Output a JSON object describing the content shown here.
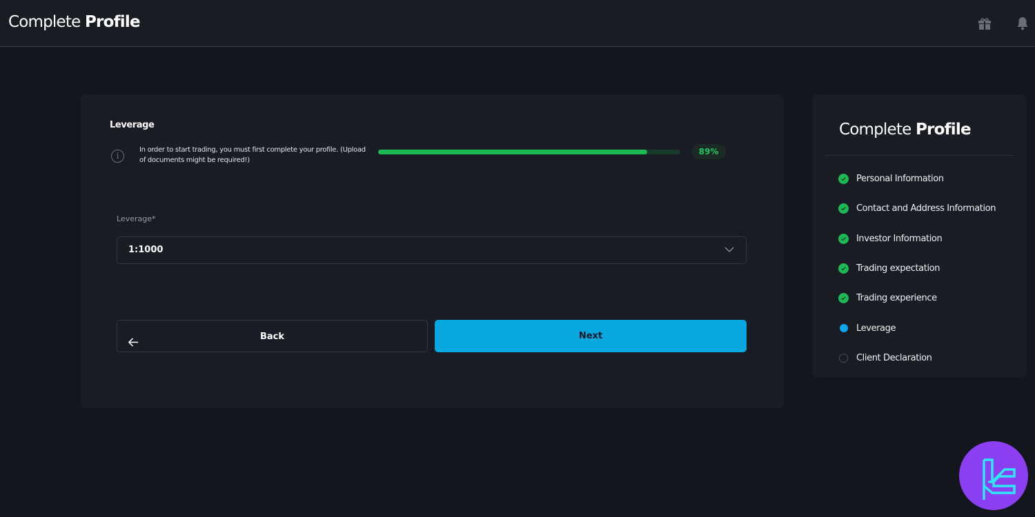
{
  "header": {
    "title_light": "Complete",
    "title_bold": "Profile",
    "icons": [
      "gift-icon",
      "bell-icon"
    ]
  },
  "form": {
    "section_title": "Leverage",
    "info_text": "In order to start trading, you must first complete your profile. (Upload of documents might be required!)",
    "progress_percent": 89,
    "progress_label": "89%",
    "leverage_label": "Leverage*",
    "leverage_value": "1:1000",
    "back_label": "Back",
    "next_label": "Next"
  },
  "sidebar": {
    "title_light": "Complete",
    "title_bold": "Profile",
    "steps": [
      {
        "label": "Personal Information",
        "status": "done"
      },
      {
        "label": "Contact and Address Information",
        "status": "done"
      },
      {
        "label": "Investor Information",
        "status": "done"
      },
      {
        "label": "Trading expectation",
        "status": "done"
      },
      {
        "label": "Trading experience",
        "status": "done"
      },
      {
        "label": "Leverage",
        "status": "current"
      },
      {
        "label": "Client Declaration",
        "status": "pending"
      }
    ]
  },
  "colors": {
    "accent": "#07a8e0",
    "success": "#1db954",
    "current_step": "#0ea5e9",
    "badge": "#8b3ff0"
  }
}
